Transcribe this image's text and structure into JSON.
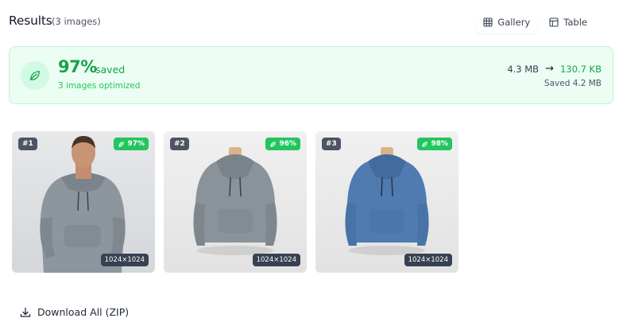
{
  "header": {
    "title": "Results",
    "count": "(3 images)",
    "views": [
      {
        "label": "Gallery",
        "icon": "grid-icon",
        "active": true
      },
      {
        "label": "Table",
        "icon": "table-icon",
        "active": false
      }
    ]
  },
  "summary": {
    "percent": "97%",
    "saved_word": "saved",
    "optimized": "3 images optimized",
    "size_from": "4.3 MB",
    "size_to": "130.7 KB",
    "saved_amount": "Saved 4.2 MB",
    "colors": {
      "accent": "#16a34a",
      "background": "#ecfdf3"
    }
  },
  "images": [
    {
      "index": "#1",
      "reduction": "97%",
      "dimensions": "1024×1024",
      "subject": "man-wearing-gray-hoodie"
    },
    {
      "index": "#2",
      "reduction": "96%",
      "dimensions": "1024×1024",
      "subject": "gray-hoodie-on-mannequin"
    },
    {
      "index": "#3",
      "reduction": "98%",
      "dimensions": "1024×1024",
      "subject": "blue-hoodie-on-mannequin"
    }
  ],
  "actions": {
    "download_label": "Download All (ZIP)"
  }
}
